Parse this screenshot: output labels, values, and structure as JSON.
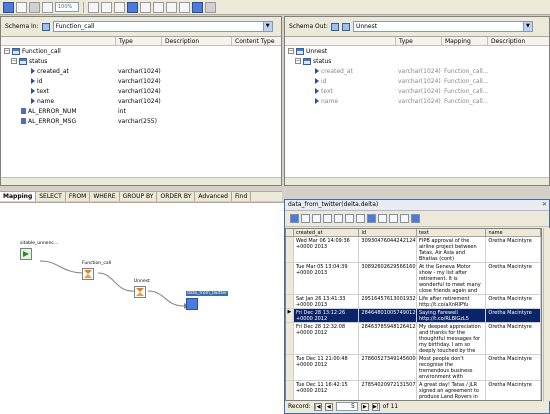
{
  "toolbar": {
    "zoom": "100%"
  },
  "schema_in": {
    "label": "Schema In:",
    "selected": "Function_call",
    "columns": [
      "Type",
      "Description",
      "Content Type"
    ],
    "rows": [
      {
        "name": "Function_call",
        "type": "",
        "level": 0
      },
      {
        "name": "status",
        "type": "",
        "level": 1
      },
      {
        "name": "created_at",
        "type": "varchar(1024)",
        "level": 2
      },
      {
        "name": "id",
        "type": "varchar(1024)",
        "level": 2
      },
      {
        "name": "text",
        "type": "varchar(1024)",
        "level": 2
      },
      {
        "name": "name",
        "type": "varchar(1024)",
        "level": 2
      },
      {
        "name": "AL_ERROR_NUM",
        "type": "int",
        "level": 1
      },
      {
        "name": "AL_ERROR_MSG",
        "type": "varchar(255)",
        "level": 1
      }
    ]
  },
  "schema_out": {
    "label": "Schema Out:",
    "selected": "Unnest",
    "columns": [
      "Type",
      "Mapping",
      "Description"
    ],
    "rows": [
      {
        "name": "Unnest",
        "type": "",
        "mapping": "",
        "level": 0
      },
      {
        "name": "status",
        "type": "",
        "mapping": "",
        "level": 1
      },
      {
        "name": "created_at",
        "type": "varchar(1024)",
        "mapping": "Function_call...",
        "level": 2
      },
      {
        "name": "id",
        "type": "varchar(1024)",
        "mapping": "Function_call...",
        "level": 2
      },
      {
        "name": "text",
        "type": "varchar(1024)",
        "mapping": "Function_call...",
        "level": 2
      },
      {
        "name": "name",
        "type": "varchar(1024)",
        "mapping": "Function_call...",
        "level": 2
      }
    ]
  },
  "tabs": [
    "Mapping",
    "SELECT",
    "FROM",
    "WHERE",
    "GROUP BY",
    "ORDER BY",
    "Advanced",
    "Find"
  ],
  "flow": {
    "source": "sitable_unnenc...",
    "function": "Function_call",
    "unnest": "Unnest",
    "target": "data_from_twitter"
  },
  "data_window": {
    "title": "data_from_twitter(delta.delta)",
    "columns": [
      "created_at",
      "id",
      "text",
      "name"
    ],
    "rows": [
      {
        "created_at": "Wed Mar 06 14:09:36 +0000 2013",
        "id": "309304760442421249",
        "text": "FIPB approval of the airline project between Tatas, Air Asia and Bhatias (cont) http://t.co/yKk64IDPm",
        "name": "Oretha Macintyre"
      },
      {
        "created_at": "Tue Mar 05 13:04:39 +0000 2013",
        "id": "308926026295661601",
        "text": "At the Geneva Motor show - my list after retirement. It is wonderful to meet many close friends again and view all the new cars",
        "name": "Oretha Macintyre"
      },
      {
        "created_at": "Sat Jan 26 13:41:33 +0000 2013",
        "id": "295164576130019329",
        "text": "Life after retirement http://t.co/aXnRlPYu",
        "name": "Oretha Macintyre"
      },
      {
        "created_at": "Fri Dec 28 13:12:26 +0000 2012",
        "id": "284648010057490129",
        "text": "Saying Farewell http://t.co/RLBlGzL5",
        "name": "Oretha Macintyre"
      },
      {
        "created_at": "Fri Dec 28 12:32:08 +0000 2012",
        "id": "284637859481264128",
        "text": "My deepest appreciation and thanks for the thoughtful messages for my birthday. I am so deeply touched by the kind sentiments expressed",
        "name": "Oretha Macintyre"
      },
      {
        "created_at": "Tue Dec 11 21:00:48 +0000 2012",
        "id": "278605273491456000",
        "text": "Most people don't recognise the tremendous business environment with impressive people.",
        "name": "Oretha Macintyre"
      },
      {
        "created_at": "Tue Dec 11 16:42:15 +0000 2012",
        "id": "278540209721315072",
        "text": "A great day! Tatas / JLR signed an agreement to produce Land Rovers in",
        "name": "Oretha Macintyre"
      }
    ],
    "selected_row": 3,
    "record_label": "Record:",
    "record_current": "5",
    "record_of": "of 11"
  }
}
